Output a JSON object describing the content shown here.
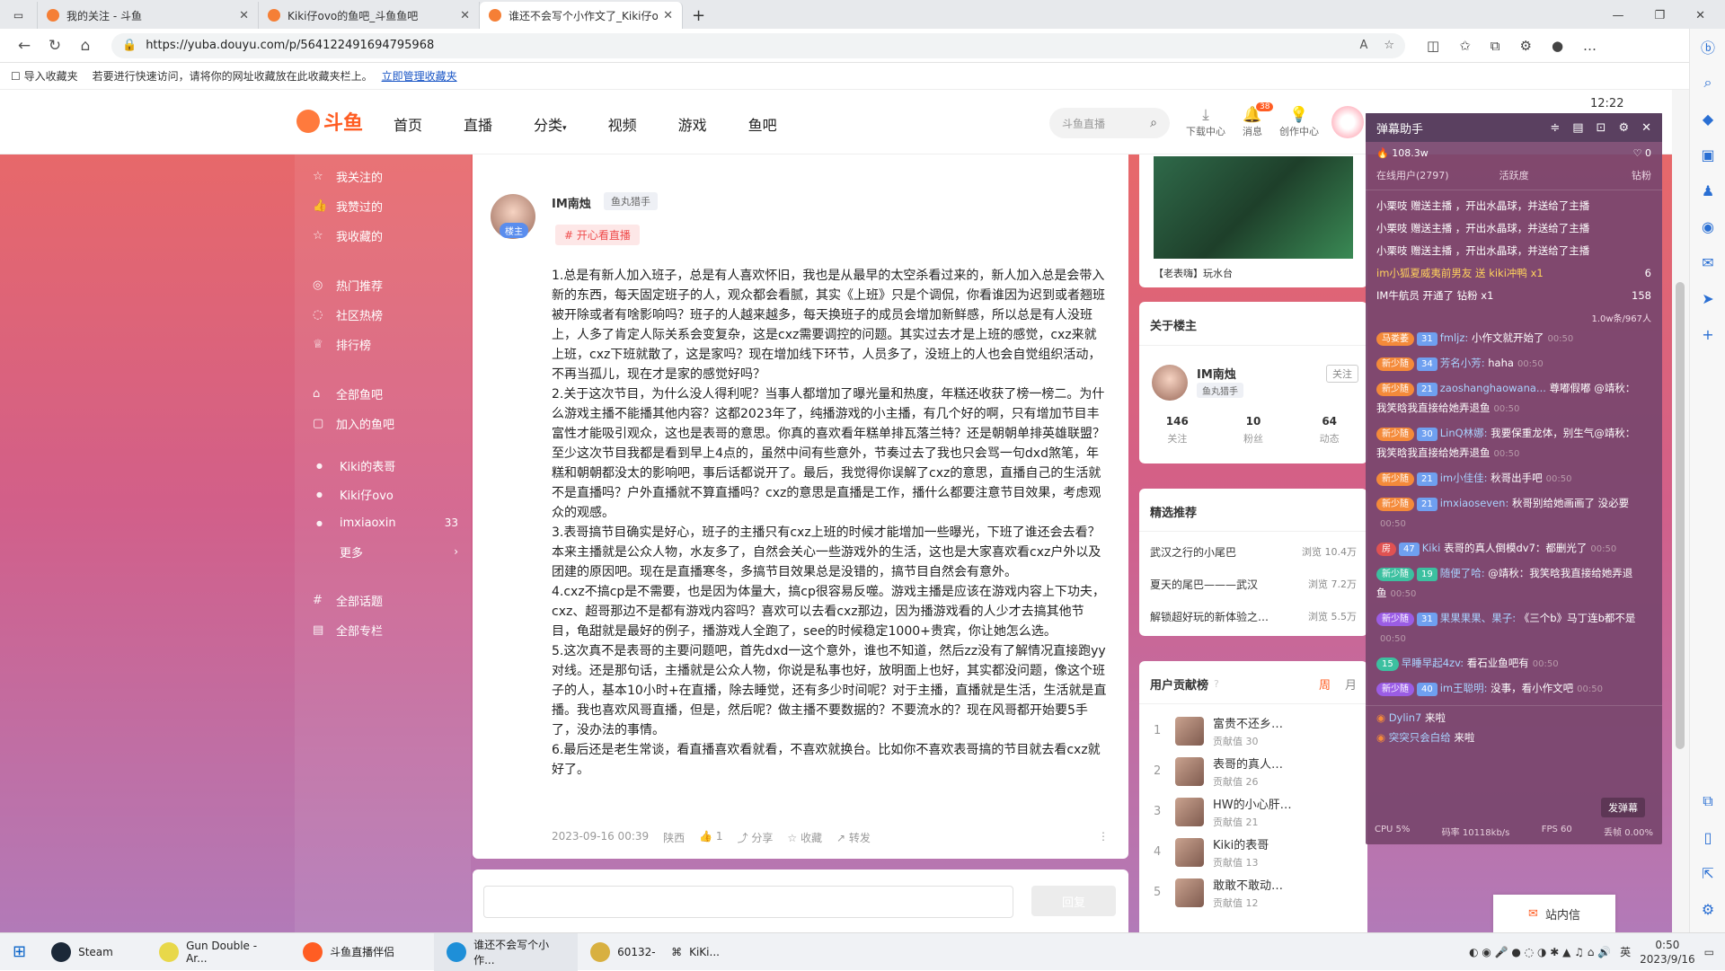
{
  "browser": {
    "tabs": [
      {
        "title": "我的关注 - 斗鱼"
      },
      {
        "title": "Kiki仔ovo的鱼吧_斗鱼鱼吧"
      },
      {
        "title": "谁还不会写个小作文了_Kiki仔ovo"
      }
    ],
    "url": "https://yuba.douyu.com/p/564122491694795968",
    "bookmarks": {
      "import_label": "导入收藏夹",
      "hint": "若要进行快速访问，请将你的网址收藏放在此收藏夹栏上。",
      "manage_link": "立即管理收藏夹"
    }
  },
  "site_header": {
    "logo": "斗鱼",
    "nav": [
      "首页",
      "直播",
      "分类",
      "视频",
      "游戏",
      "鱼吧"
    ],
    "search_placeholder": "斗鱼直播",
    "icons": [
      {
        "label": "下载中心",
        "icon": "download-icon"
      },
      {
        "label": "消息",
        "icon": "bell-icon",
        "badge": "38"
      },
      {
        "label": "创作中心",
        "icon": "bulb-icon"
      }
    ]
  },
  "left_menu": {
    "group1": [
      {
        "label": "我关注的",
        "icon": "star-icon"
      },
      {
        "label": "我赞过的",
        "icon": "thumb-icon"
      },
      {
        "label": "我收藏的",
        "icon": "bookmark-icon"
      }
    ],
    "group2": [
      {
        "label": "热门推荐",
        "icon": "fire-icon"
      },
      {
        "label": "社区热榜",
        "icon": "hot-icon"
      },
      {
        "label": "排行榜",
        "icon": "trophy-icon"
      }
    ],
    "group3": [
      {
        "label": "全部鱼吧",
        "icon": "home-icon"
      },
      {
        "label": "加入的鱼吧",
        "icon": "group-icon"
      }
    ],
    "sub": [
      {
        "label": "Kiki的表哥",
        "count": ""
      },
      {
        "label": "Kiki仔ovo",
        "count": ""
      },
      {
        "label": "imxiaoxin",
        "count": "33"
      }
    ],
    "more": "更多",
    "group4": [
      {
        "label": "全部话题",
        "icon": "hash-icon"
      },
      {
        "label": "全部专栏",
        "icon": "column-icon"
      }
    ]
  },
  "post": {
    "author": "IM南烛",
    "author_tag": "鱼丸猎手",
    "author_badge": "楼主",
    "topic": "# 开心看直播",
    "paragraphs": [
      "1.总是有新人加入班子，总是有人喜欢怀旧，我也是从最早的太空杀看过来的，新人加入总是会带入新的东西，每天固定班子的人，观众都会看腻，其实《上班》只是个调侃，你看谁因为迟到或者翘班被开除或者有啥影响吗？班子的人越来越多，每天换班子的成员会增加新鲜感，所以总是有人没班上，人多了肯定人际关系会变复杂，这是cxz需要调控的问题。其实过去才是上班的感觉，cxz来就上班，cxz下班就散了，这是家吗？现在增加线下环节，人员多了，没班上的人也会自觉组织活动，不再当孤儿，现在才是家的感觉好吗？",
      "2.关于这次节目，为什么没人得利呢？当事人都增加了曝光量和热度，年糕还收获了榜一榜二。为什么游戏主播不能播其他内容？这都2023年了，纯播游戏的小主播，有几个好的啊，只有增加节目丰富性才能吸引观众，这也是表哥的意思。你真的喜欢看年糕单排瓦落兰特？还是朝朝单排英雄联盟？至少这次节目我都是看到早上4点的，虽然中间有些意外，节奏过去了我也只会骂一句dxd煞笔，年糕和朝朝都没太的影响吧，事后话都说开了。最后，我觉得你误解了cxz的意思，直播自己的生活就不是直播吗？户外直播就不算直播吗？cxz的意思是直播是工作，播什么都要注意节目效果，考虑观众的观感。",
      "3.表哥搞节目确实是好心，班子的主播只有cxz上班的时候才能增加一些曝光，下班了谁还会去看？本来主播就是公众人物，水友多了，自然会关心一些游戏外的生活，这也是大家喜欢看cxz户外以及团建的原因吧。现在是直播寒冬，多搞节目效果总是没错的，搞节目自然会有意外。",
      "4.cxz不搞cp是不需要，也是因为体量大，搞cp很容易反噬。游戏主播是应该在游戏内容上下功夫，cxz、超哥那边不是都有游戏内容吗？喜欢可以去看cxz那边，因为播游戏看的人少才去搞其他节目，龟甜就是最好的例子，播游戏人全跑了，see的时候稳定1000+贵宾，你让她怎么选。",
      "5.这次真不是表哥的主要问题吧，首先dxd一这个意外，谁也不知道，然后zz没有了解情况直接跑yy对线。还是那句话，主播就是公众人物，你说是私事也好，放明面上也好，其实都没问题，像这个班子的人，基本10小时+在直播，除去睡觉，还有多少时间呢？对于主播，直播就是生活，生活就是直播。我也喜欢风哥直播，但是，然后呢？做主播不要数据的？不要流水的？现在风哥都开始要5手了，没办法的事情。",
      "6.最后还是老生常谈，看直播喜欢看就看，不喜欢就换台。比如你不喜欢表哥搞的节目就去看cxz就好了。"
    ],
    "meta": {
      "time": "2023-09-16 00:39",
      "location": "陕西",
      "likes": "1",
      "share": "分享",
      "collect": "收藏",
      "forward": "转发"
    },
    "reply_button": "回复"
  },
  "right": {
    "video_caption": "【老表嗨】玩水台",
    "about": {
      "title": "关于楼主",
      "name": "IM南烛",
      "tag": "鱼丸猎手",
      "follow": "关注",
      "stats": [
        {
          "value": "146",
          "label": "关注"
        },
        {
          "value": "10",
          "label": "粉丝"
        },
        {
          "value": "64",
          "label": "动态"
        }
      ]
    },
    "featured": {
      "title": "精选推荐",
      "items": [
        {
          "title": "武汉之行的小尾巴",
          "views": "浏览 10.4万"
        },
        {
          "title": "夏天的尾巴———武汉",
          "views": "浏览 7.2万"
        },
        {
          "title": "解锁超好玩的新体验之…",
          "views": "浏览 5.5万"
        }
      ]
    },
    "contrib": {
      "title": "用户贡献榜",
      "tabs": [
        "周",
        "月"
      ],
      "items": [
        {
          "rank": "1",
          "name": "富贵不还乡…",
          "value": "贡献值 30"
        },
        {
          "rank": "2",
          "name": "表哥的真人…",
          "value": "贡献值 26"
        },
        {
          "rank": "3",
          "name": "HW的小心肝…",
          "value": "贡献值 21"
        },
        {
          "rank": "4",
          "name": "Kiki的表哥",
          "value": "贡献值 13"
        },
        {
          "rank": "5",
          "name": "敢敢不敢动…",
          "value": "贡献值 12"
        }
      ]
    },
    "mail": "站内信"
  },
  "danmaku": {
    "title": "弹幕助手",
    "heat": "108.3w",
    "likes": "0",
    "online": "在线用户(2797)",
    "activity": "活跃度",
    "diamond": "钻粉",
    "gift_lines": [
      "小栗吱 赠送主播 ，开出水晶球，并送给了主播",
      "小栗吱 赠送主播 ，开出水晶球，并送给了主播",
      "小栗吱 赠送主播 ，开出水晶球，并送给了主播",
      "im小狐夏威夷前男友 送 kiki冲鸭 x1",
      "IM牛航员 开通了 钻粉 x1"
    ],
    "counts": [
      "6",
      "158"
    ],
    "online_tag": "1.0w条/967人",
    "messages": [
      {
        "lvl": "马娄萎",
        "fan": "31",
        "user": "fmljz:",
        "text": "小作文就开始了",
        "time": "00:50"
      },
      {
        "lvl": "新少随",
        "fan": "34",
        "user": "芳名小芳:",
        "text": "haha",
        "time": "00:50"
      },
      {
        "lvl": "新少随",
        "fan": "21",
        "user": "zaoshanghaowana...",
        "text": "尊嘟假嘟 @靖秋：我笑晗我直接给她弄退鱼",
        "time": "00:50"
      },
      {
        "lvl": "新少随",
        "fan": "30",
        "user": "LinQ林娜:",
        "text": "我要保重龙体，别生气@靖秋：我笑晗我直接给她弄退鱼",
        "time": "00:50"
      },
      {
        "lvl": "新少随",
        "fan": "21",
        "user": "im小佳佳:",
        "text": "秋哥出手吧",
        "time": "00:50"
      },
      {
        "lvl": "新少随",
        "fan": "21",
        "user": "imxiaoseven:",
        "text": "秋哥别给她画画了 没必要",
        "time": "00:50"
      },
      {
        "lvl": "房",
        "fan": "47",
        "user": "Kiki",
        "text": "表哥的真人倒模dv7：都删光了",
        "time": "00:50"
      },
      {
        "lvl": "新少随",
        "fan": "19",
        "user": "随便了哈:",
        "text": "@靖秋：我笑晗我直接给她弄退鱼",
        "time": "00:50"
      },
      {
        "lvl": "新少随",
        "fan": "31",
        "user": "果果果果、果子:",
        "text": "《三个b》马丁连b都不是",
        "time": "00:50"
      },
      {
        "lvl": "15",
        "fan": "",
        "user": "早睡早起4zv:",
        "text": "看石业鱼吧有",
        "time": "00:50"
      },
      {
        "lvl": "新少随",
        "fan": "40",
        "user": "im王聪明:",
        "text": "没事，看小作文吧",
        "time": "00:50"
      },
      {
        "lvl": "",
        "fan": "",
        "user": "Dylin7",
        "text": "来啦",
        "time": ""
      },
      {
        "lvl": "",
        "fan": "",
        "user": "突突只会白给",
        "text": "来啦",
        "time": ""
      }
    ],
    "send_button": "发弹幕",
    "status": {
      "cpu": "CPU 5%",
      "bitrate": "码率 10118kb/s",
      "fps": "FPS 60",
      "drop": "丢帧 0.00%"
    },
    "clock_overlay": "12:22"
  },
  "taskbar": {
    "items": [
      "Steam",
      "Gun Double - Ar...",
      "斗鱼直播伴侣",
      "谁还不会写个小作...",
      "60132-",
      "KiKi..."
    ],
    "ime": "英",
    "time": "0:50",
    "date": "2023/9/16"
  }
}
